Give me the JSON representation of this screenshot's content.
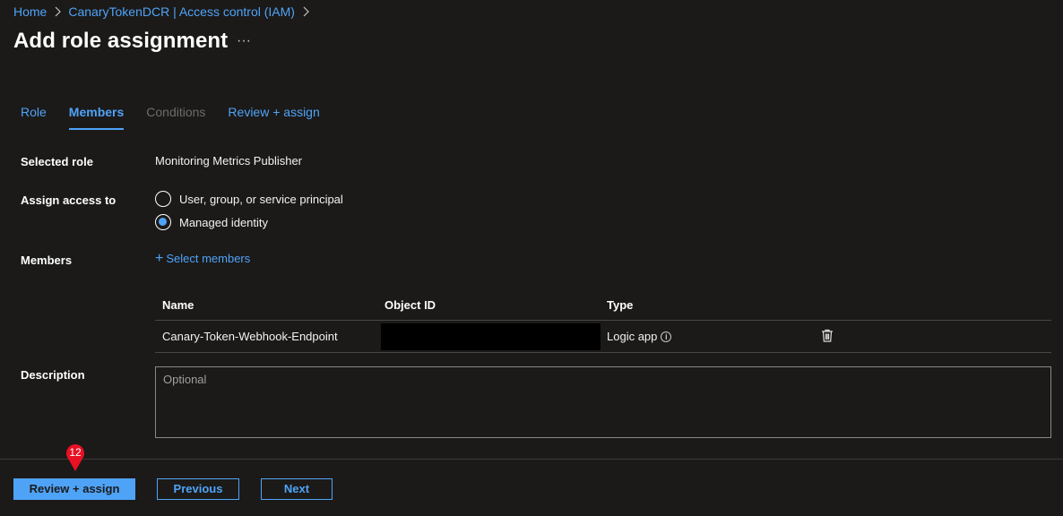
{
  "breadcrumb": {
    "items": [
      "Home",
      "CanaryTokenDCR | Access control (IAM)"
    ]
  },
  "page": {
    "title": "Add role assignment",
    "more_label": "···"
  },
  "tabs": [
    {
      "label": "Role",
      "state": "link"
    },
    {
      "label": "Members",
      "state": "active"
    },
    {
      "label": "Conditions",
      "state": "disabled"
    },
    {
      "label": "Review + assign",
      "state": "link"
    }
  ],
  "form": {
    "selected_role_label": "Selected role",
    "selected_role_value": "Monitoring Metrics Publisher",
    "assign_access_label": "Assign access to",
    "assign_options": [
      {
        "label": "User, group, or service principal",
        "checked": false
      },
      {
        "label": "Managed identity",
        "checked": true
      }
    ],
    "members_label": "Members",
    "select_members": "Select members",
    "description_label": "Description",
    "description_placeholder": "Optional"
  },
  "members_table": {
    "headers": [
      "Name",
      "Object ID",
      "Type"
    ],
    "rows": [
      {
        "name": "Canary-Token-Webhook-Endpoint",
        "object_id": "",
        "type": "Logic app"
      }
    ]
  },
  "footer": {
    "review_assign": "Review + assign",
    "previous": "Previous",
    "next": "Next"
  },
  "step_marker": {
    "number": "12",
    "color": "#e81123"
  },
  "colors": {
    "accent": "#4fa3f7",
    "background": "#1b1a19"
  }
}
